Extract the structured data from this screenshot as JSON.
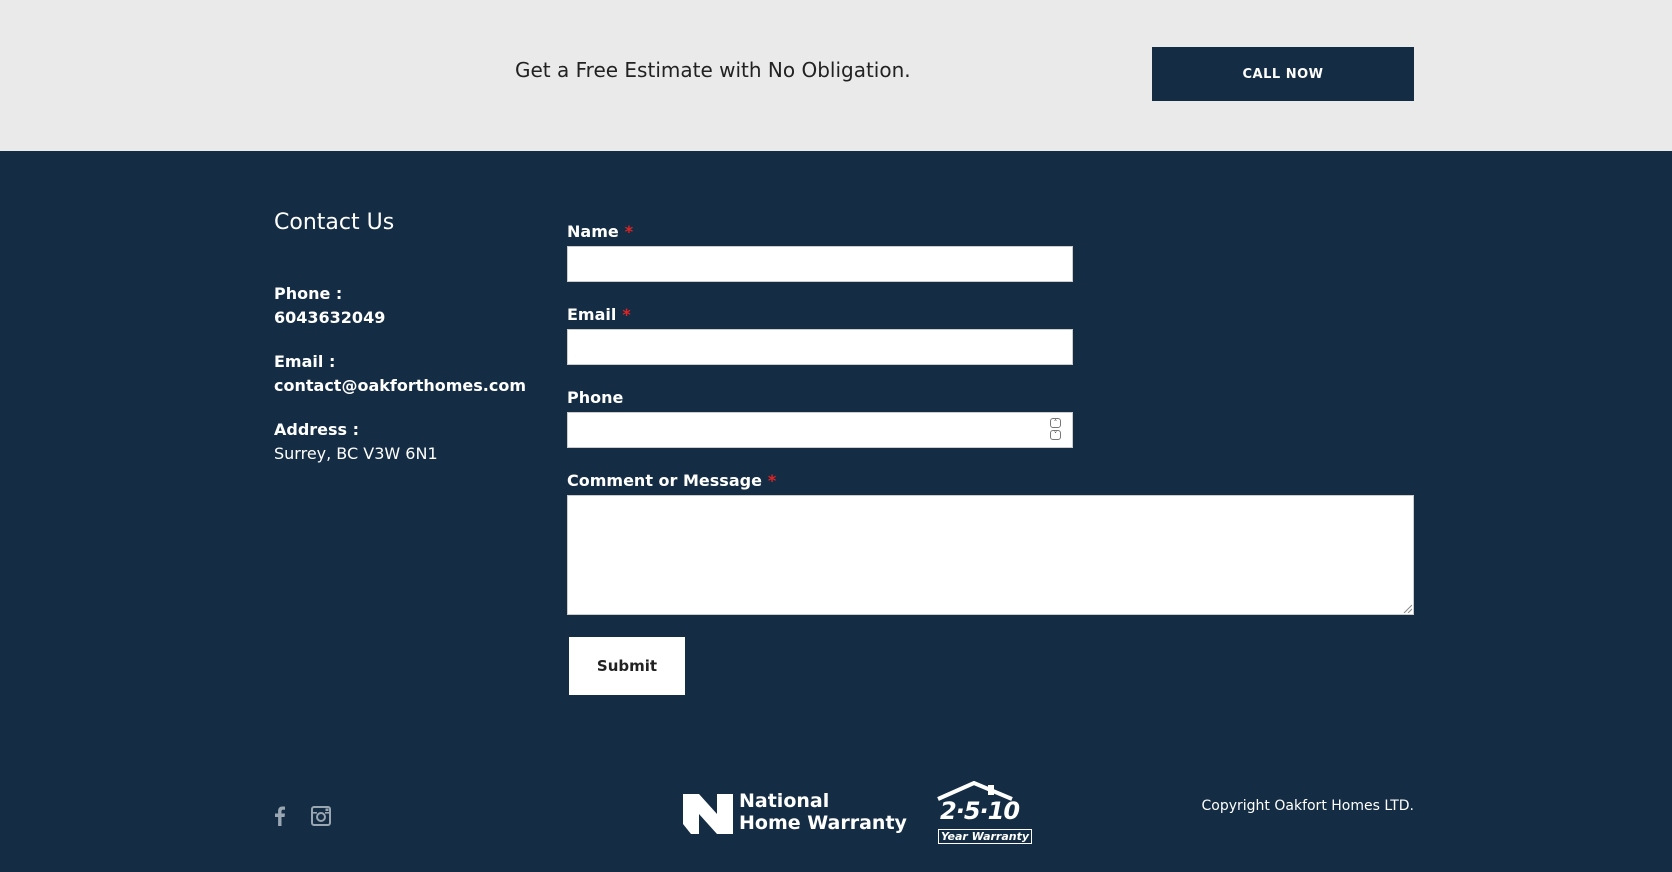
{
  "cta": {
    "tagline": "Get a Free Estimate with No Obligation.",
    "button_label": "CALL NOW"
  },
  "contact": {
    "title": "Contact Us",
    "phone_label": "Phone :",
    "phone_value": "6043632049",
    "email_label": "Email :",
    "email_value": "contact@oakforthomes.com",
    "address_label": "Address :",
    "address_value": "Surrey, BC V3W 6N1"
  },
  "form": {
    "name_label": "Name",
    "email_label": "Email",
    "phone_label": "Phone",
    "message_label": "Comment or Message",
    "required_mark": "*",
    "name_value": "",
    "email_value": "",
    "phone_value": "",
    "message_value": "",
    "submit_label": "Submit"
  },
  "footer": {
    "social_icons": [
      "facebook-icon",
      "instagram-icon"
    ],
    "logo_nhw_line1": "National",
    "logo_nhw_line2": "Home Warranty",
    "logo_warranty_number": "2·5·10",
    "logo_warranty_text": "Year Warranty",
    "copyright": "Copyright Oakfort Homes LTD."
  },
  "colors": {
    "navy": "#142d44",
    "band": "#eaeaea",
    "required": "#e02424"
  }
}
